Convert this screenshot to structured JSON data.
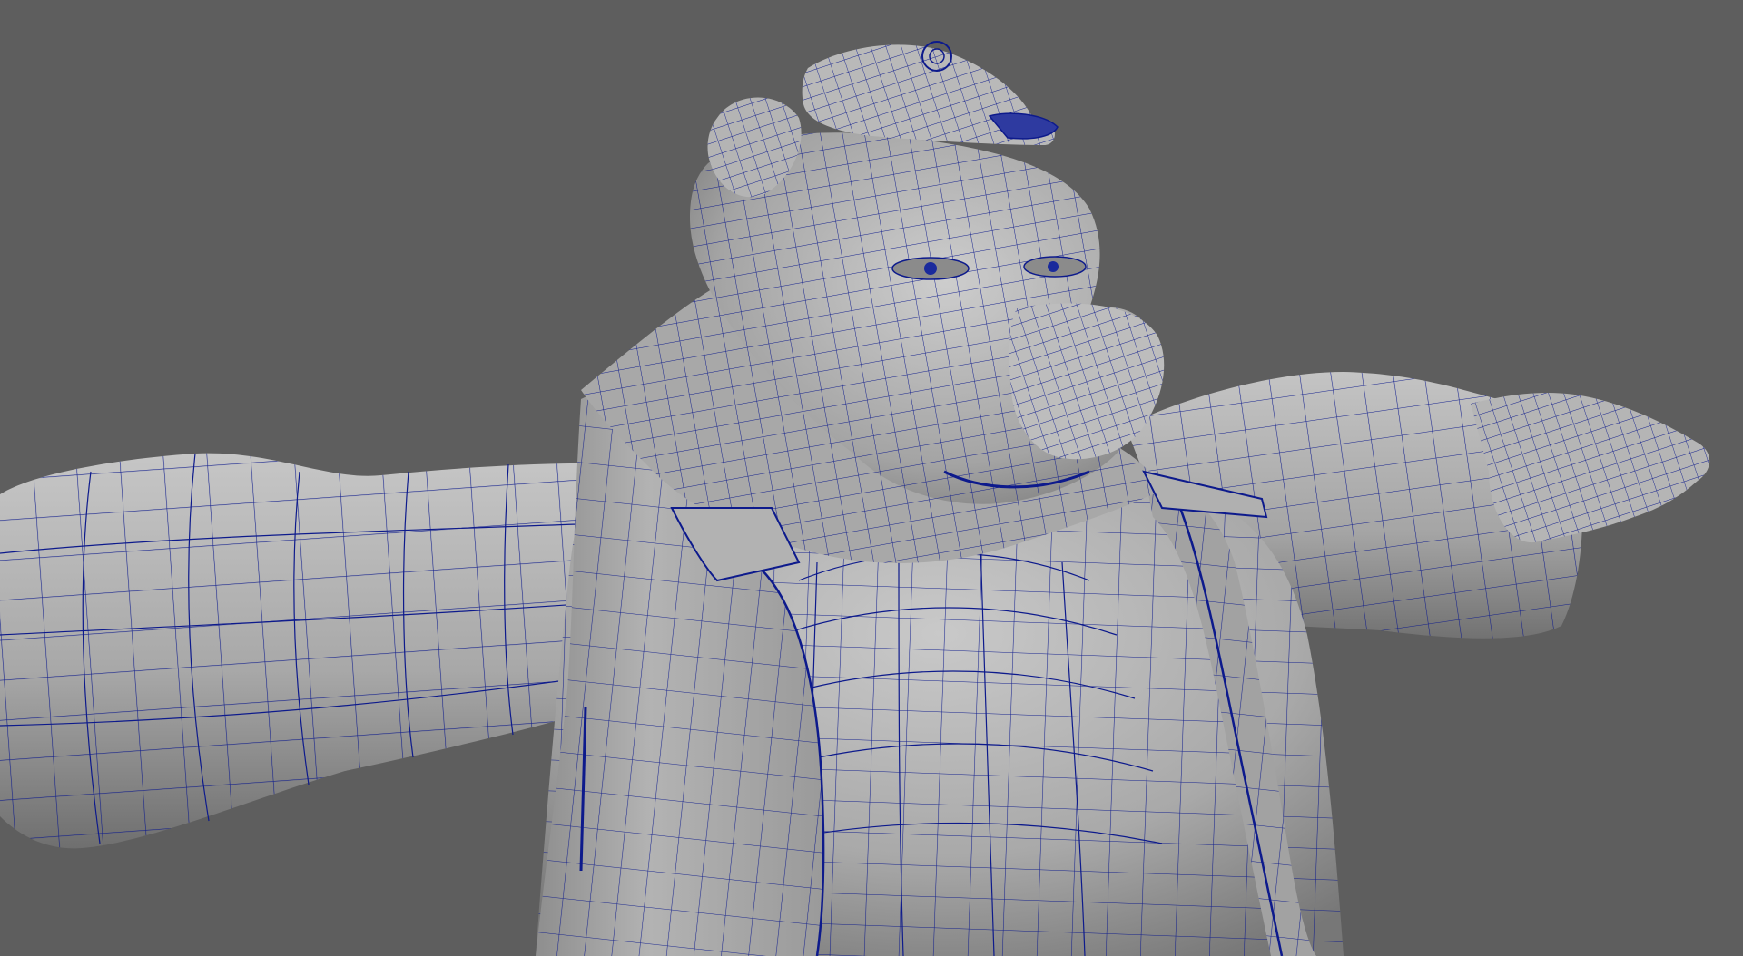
{
  "viewport": {
    "background": "#5e5e5e",
    "mesh_color": "#0d1a8c",
    "surface_light": "#b9b9b9",
    "surface_mid": "#9a9a9a",
    "surface_dark": "#6e6e6e"
  },
  "model": {
    "display_mode": "wireframe-on-shaded",
    "subject": "bear-character-with-cap-and-jacket"
  }
}
